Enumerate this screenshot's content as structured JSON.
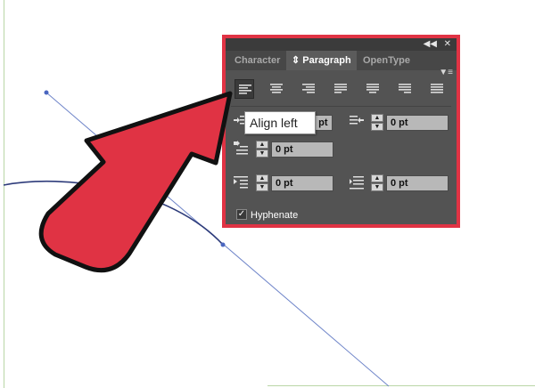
{
  "panel": {
    "tabs": [
      {
        "label": "Character",
        "active": false
      },
      {
        "label": "Paragraph",
        "active": true
      },
      {
        "label": "OpenType",
        "active": false
      }
    ],
    "collapse_icon": "double-chevron-icon",
    "close_icon": "close-icon",
    "menu_icon": "panel-menu-icon",
    "alignment_buttons": [
      "align-left",
      "align-center",
      "align-right",
      "justify-last-left",
      "justify-last-center",
      "justify-last-right",
      "justify-all"
    ],
    "selected_alignment": "align-left",
    "tooltip": "Align left",
    "fields": {
      "left_indent": "0 pt",
      "right_indent": "0 pt",
      "first_line_indent": "0 pt",
      "space_before": "0 pt",
      "space_after": "0 pt"
    },
    "hyphenate": {
      "label": "Hyphenate",
      "checked": true
    }
  },
  "colors": {
    "highlight_border": "#e03344",
    "arrow_fill": "#e03344",
    "panel_bg": "#535353"
  }
}
